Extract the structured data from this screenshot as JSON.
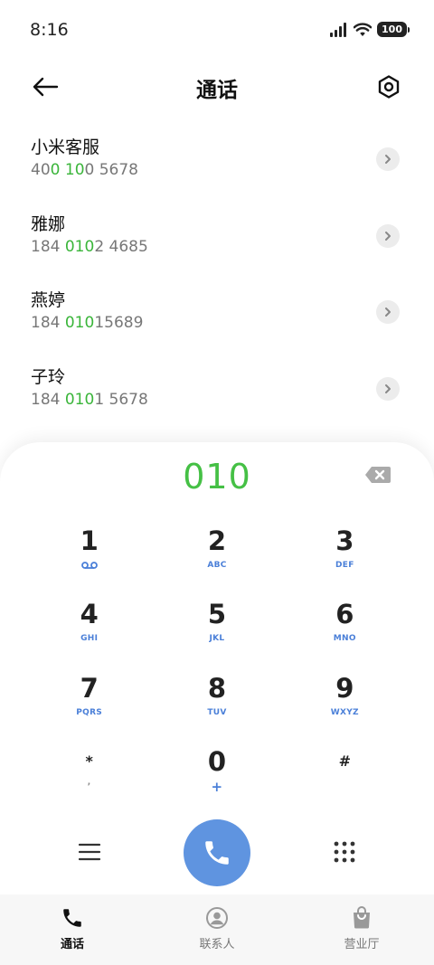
{
  "status_bar": {
    "time": "8:16",
    "battery": "100",
    "icons": [
      "signal-icon",
      "wifi-icon",
      "battery-icon"
    ]
  },
  "header": {
    "title": "通话",
    "back_icon": "arrow-left-icon",
    "settings_icon": "hexagon-settings-icon"
  },
  "results": [
    {
      "name": "小米客服",
      "number_parts": [
        "40",
        "0",
        " ",
        "10",
        "0 5678"
      ],
      "highlight": [
        false,
        true,
        false,
        true,
        false
      ]
    },
    {
      "name": "雅娜",
      "number_parts": [
        "184 ",
        "010",
        "2 4685"
      ],
      "highlight": [
        false,
        true,
        false
      ]
    },
    {
      "name": "燕婷",
      "number_parts": [
        "184 ",
        "010",
        "15689"
      ],
      "highlight": [
        false,
        true,
        false
      ]
    },
    {
      "name": "子玲",
      "number_parts": [
        "184 ",
        "010",
        "1 5678"
      ],
      "highlight": [
        false,
        true,
        false
      ]
    }
  ],
  "dialpad": {
    "display": "010",
    "keys": [
      {
        "digit": "1",
        "sub": "voicemail-icon"
      },
      {
        "digit": "2",
        "sub": "ABC"
      },
      {
        "digit": "3",
        "sub": "DEF"
      },
      {
        "digit": "4",
        "sub": "GHI"
      },
      {
        "digit": "5",
        "sub": "JKL"
      },
      {
        "digit": "6",
        "sub": "MNO"
      },
      {
        "digit": "7",
        "sub": "PQRS"
      },
      {
        "digit": "8",
        "sub": "TUV"
      },
      {
        "digit": "9",
        "sub": "WXYZ"
      },
      {
        "digit": "*",
        "sub": ","
      },
      {
        "digit": "0",
        "sub": "+"
      },
      {
        "digit": "#",
        "sub": ""
      }
    ]
  },
  "colors": {
    "highlight_green": "#3ab53a",
    "display_green": "#45c045",
    "call_blue": "#5f94e0",
    "sub_label_blue": "#4a7fd8"
  },
  "bottom_nav": [
    {
      "label": "通话",
      "icon": "phone-icon",
      "active": true
    },
    {
      "label": "联系人",
      "icon": "contact-icon",
      "active": false
    },
    {
      "label": "营业厅",
      "icon": "shopping-bag-icon",
      "active": false
    }
  ]
}
